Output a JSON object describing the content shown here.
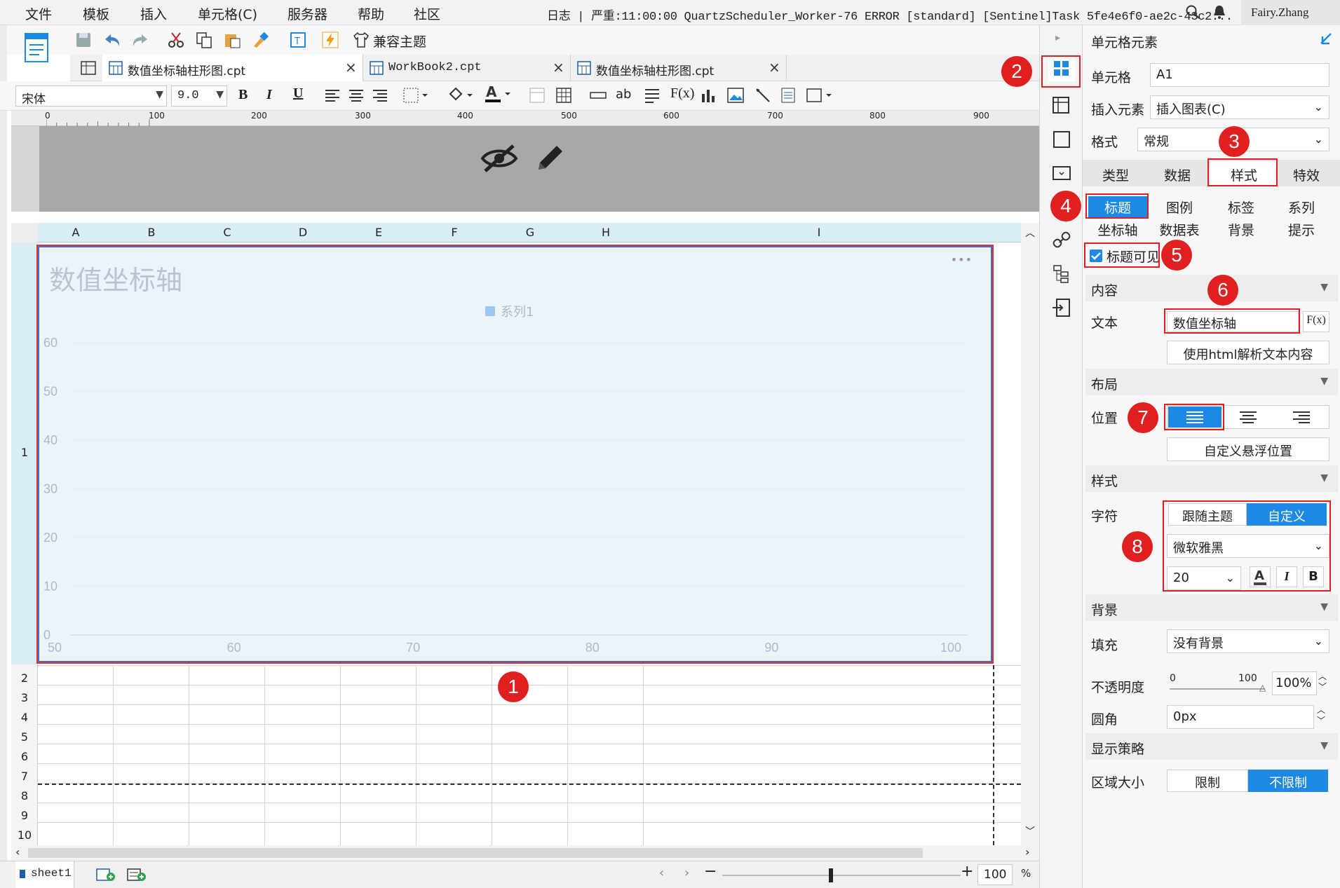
{
  "menubar": {
    "items": [
      "文件",
      "模板",
      "插入",
      "单元格(C)",
      "服务器",
      "帮助",
      "社区"
    ],
    "log": "日志 | 严重:11:00:00 QuartzScheduler_Worker-76 ERROR [standard] [Sentinel]Task 5fe4e6f0-ae2c-43c2...",
    "user": "Fairy.Zhang"
  },
  "toolbar": {
    "compat_theme_label": "兼容主题"
  },
  "tabs": [
    {
      "label": "数值坐标轴柱形图.cpt",
      "close": "×"
    },
    {
      "label": "WorkBook2.cpt",
      "close": "×"
    },
    {
      "label": "数值坐标轴柱形图.cpt",
      "close": "×"
    }
  ],
  "format_bar": {
    "font": "宋体",
    "size": "9.0"
  },
  "ruler": {
    "ticks": [
      "0",
      "100",
      "200",
      "300",
      "400",
      "500",
      "600",
      "700",
      "800",
      "900"
    ]
  },
  "grid": {
    "columns": [
      "A",
      "B",
      "C",
      "D",
      "E",
      "F",
      "G",
      "H",
      "I"
    ],
    "rows": [
      "1",
      "2",
      "3",
      "4",
      "5",
      "6",
      "7",
      "8",
      "9",
      "10"
    ]
  },
  "chart": {
    "more": "•••"
  },
  "chart_data": {
    "type": "bar",
    "title": "数值坐标轴",
    "legend": [
      "系列1"
    ],
    "series": [
      {
        "name": "系列1",
        "values": []
      }
    ],
    "x_ticks": [
      "50",
      "60",
      "70",
      "80",
      "90",
      "100"
    ],
    "y_ticks": [
      "0",
      "10",
      "20",
      "30",
      "40",
      "50",
      "60"
    ],
    "xlim": [
      50,
      100
    ],
    "ylim": [
      0,
      60
    ],
    "legend_position": "top",
    "grid": true
  },
  "sheet": {
    "name": "sheet1",
    "zoom": "100",
    "zoom_unit": "%"
  },
  "side_panel": {
    "header": "单元格元素",
    "cell_label": "单元格",
    "cell_value": "A1",
    "insert_label": "插入元素",
    "insert_value": "插入图表(C)",
    "format_label": "格式",
    "format_value": "常规",
    "main_tabs": [
      "类型",
      "数据",
      "样式",
      "特效"
    ],
    "sub_tabs_row1": [
      "标题",
      "图例",
      "标签",
      "系列"
    ],
    "sub_tabs_row2": [
      "坐标轴",
      "数据表",
      "背景",
      "提示"
    ],
    "title_visible_label": "标题可见",
    "content_section": "内容",
    "text_label": "文本",
    "text_value": "数值坐标轴",
    "fx_label": "F(x)",
    "html_button": "使用html解析文本内容",
    "layout_section": "布局",
    "position_label": "位置",
    "custom_float_button": "自定义悬浮位置",
    "style_section": "样式",
    "char_label": "字符",
    "follow_theme": "跟随主题",
    "custom": "自定义",
    "font_value": "微软雅黑",
    "font_size": "20",
    "bg_section": "背景",
    "fill_label": "填充",
    "fill_value": "没有背景",
    "opacity_label": "不透明度",
    "opacity_min": "0",
    "opacity_max": "100",
    "opacity_value": "100%",
    "radius_label": "圆角",
    "radius_value": "0px",
    "strategy_section": "显示策略",
    "area_label": "区域大小",
    "limit": "限制",
    "no_limit": "不限制"
  },
  "callouts": [
    "1",
    "2",
    "3",
    "4",
    "5",
    "6",
    "7",
    "8"
  ],
  "colors": {
    "accent": "#1e88e5",
    "callout": "#e02020",
    "chart_bg": "#edf3fb"
  }
}
